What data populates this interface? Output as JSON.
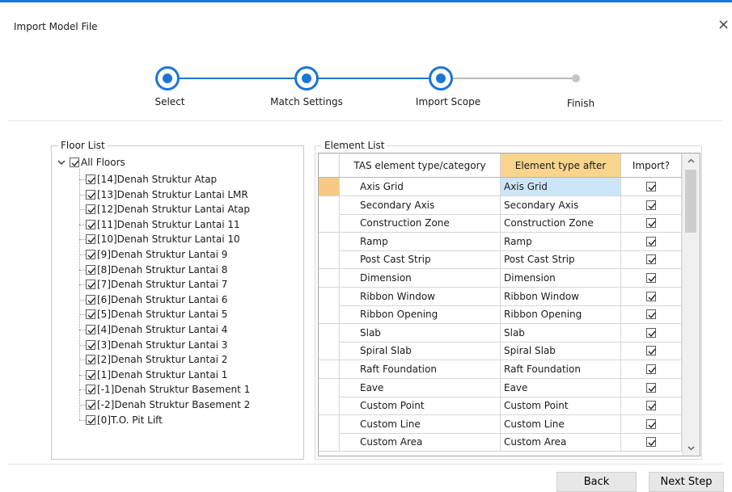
{
  "dialog": {
    "title": "Import Model File",
    "close_glyph": "×"
  },
  "steps": [
    {
      "label": "Select",
      "state": "done"
    },
    {
      "label": "Match Settings",
      "state": "done"
    },
    {
      "label": "Import Scope",
      "state": "current"
    },
    {
      "label": "Finish",
      "state": "pending"
    }
  ],
  "floor_list": {
    "legend": "Floor List",
    "root_label": "All Floors",
    "items": [
      "[14]Denah Struktur Atap",
      "[13]Denah Struktur Lantai LMR",
      "[12]Denah Struktur Lantai Atap",
      "[11]Denah Struktur Lantai 11",
      "[10]Denah Struktur Lantai 10",
      "[9]Denah Struktur Lantai 9",
      "[8]Denah Struktur Lantai 8",
      "[7]Denah Struktur Lantai 7",
      "[6]Denah Struktur Lantai 6",
      "[5]Denah Struktur Lantai 5",
      "[4]Denah Struktur Lantai 4",
      "[3]Denah Struktur Lantai 3",
      "[2]Denah Struktur Lantai 2",
      "[1]Denah Struktur Lantai 1",
      "[-1]Denah Struktur Basement 1",
      "[-2]Denah Struktur Basement 2",
      "[0]T.O. Pit Lift"
    ]
  },
  "element_list": {
    "legend": "Element List",
    "columns": [
      "TAS element type/category",
      "Element type after",
      "Import?"
    ],
    "rows": [
      [
        "Axis Grid",
        "Axis Grid"
      ],
      [
        "Secondary Axis",
        "Secondary Axis"
      ],
      [
        "Construction Zone",
        "Construction Zone"
      ],
      [
        "Ramp",
        "Ramp"
      ],
      [
        "Post Cast Strip",
        "Post Cast Strip"
      ],
      [
        "Dimension",
        "Dimension"
      ],
      [
        "Ribbon Window",
        "Ribbon Window"
      ],
      [
        "Ribbon Opening",
        "Ribbon Opening"
      ],
      [
        "Slab",
        "Slab"
      ],
      [
        "Spiral Slab",
        "Spiral Slab"
      ],
      [
        "Raft Foundation",
        "Raft Foundation"
      ],
      [
        "Eave",
        "Eave"
      ],
      [
        "Custom Point",
        "Custom Point"
      ],
      [
        "Custom Line",
        "Custom Line"
      ],
      [
        "Custom Area",
        "Custom Area"
      ]
    ]
  },
  "buttons": {
    "back": "Back",
    "next": "Next Step"
  },
  "colors": {
    "accent": "#1a76d2",
    "header_highlight": "#f9d48c",
    "selected_cell": "#cde6f7"
  }
}
